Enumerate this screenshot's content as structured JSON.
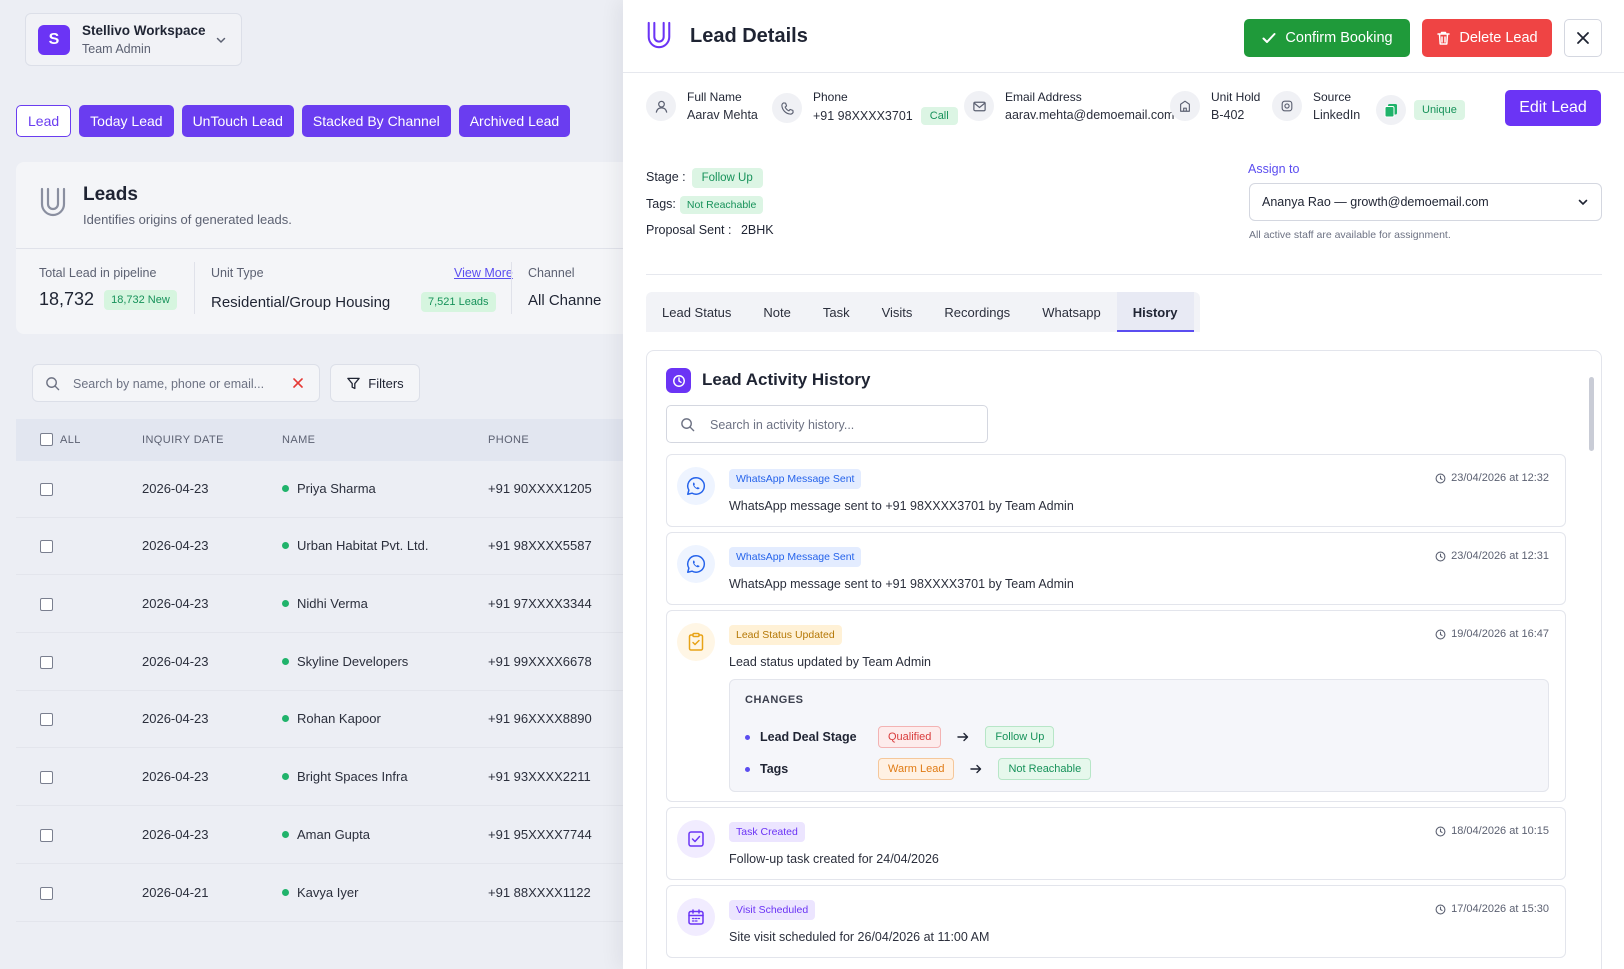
{
  "workspace": {
    "avatar": "S",
    "name": "Stellivo Workspace",
    "role": "Team Admin"
  },
  "top_tabs": [
    {
      "label": "Lead",
      "active": true
    },
    {
      "label": "Today Lead",
      "active": false
    },
    {
      "label": "UnTouch Lead",
      "active": false
    },
    {
      "label": "Stacked By Channel",
      "active": false
    },
    {
      "label": "Archived Lead",
      "active": false
    }
  ],
  "leads_panel": {
    "title": "Leads",
    "subtitle": "Identifies origins of generated leads.",
    "stats": {
      "total_label": "Total Lead in pipeline",
      "total_value": "18,732",
      "total_badge": "18,732 New",
      "unit_label": "Unit Type",
      "unit_value": "Residential/Group Housing",
      "unit_badge": "7,521 Leads",
      "view_more": "View More",
      "channel_label": "Channel",
      "channel_value": "All Channe"
    }
  },
  "list_search": {
    "placeholder": "Search by name, phone or email...",
    "filters_label": "Filters"
  },
  "table": {
    "headers": {
      "all": "ALL",
      "date": "INQUIRY DATE",
      "name": "NAME",
      "phone": "PHONE"
    },
    "rows": [
      {
        "date": "2026-04-23",
        "name": "Priya Sharma",
        "phone": "+91 90XXXX1205"
      },
      {
        "date": "2026-04-23",
        "name": "Urban Habitat Pvt. Ltd.",
        "phone": "+91 98XXXX5587"
      },
      {
        "date": "2026-04-23",
        "name": "Nidhi Verma",
        "phone": "+91 97XXXX3344"
      },
      {
        "date": "2026-04-23",
        "name": "Skyline Developers",
        "phone": "+91 99XXXX6678"
      },
      {
        "date": "2026-04-23",
        "name": "Rohan Kapoor",
        "phone": "+91 96XXXX8890"
      },
      {
        "date": "2026-04-23",
        "name": "Bright Spaces Infra",
        "phone": "+91 93XXXX2211"
      },
      {
        "date": "2026-04-23",
        "name": "Aman Gupta",
        "phone": "+91 95XXXX7744"
      },
      {
        "date": "2026-04-21",
        "name": "Kavya Iyer",
        "phone": "+91 88XXXX1122"
      }
    ]
  },
  "drawer": {
    "title": "Lead Details",
    "confirm_label": "Confirm Booking",
    "delete_label": "Delete Lead",
    "edit_label": "Edit Lead",
    "info": {
      "full_name_label": "Full Name",
      "full_name": "Aarav Mehta",
      "phone_label": "Phone",
      "phone": "+91 98XXXX3701",
      "call_label": "Call",
      "email_label": "Email Address",
      "email": "aarav.mehta@demoemail.com",
      "unit_label": "Unit Hold",
      "unit": "B-402",
      "source_label": "Source",
      "source": "LinkedIn",
      "unique_label": "Unique"
    },
    "meta": {
      "stage_label": "Stage :",
      "stage": "Follow Up",
      "tags_label": "Tags:",
      "tag": "Not Reachable",
      "proposal_label": "Proposal Sent :",
      "proposal": "2BHK"
    },
    "assign": {
      "label": "Assign to",
      "value": "Ananya Rao — growth@demoemail.com",
      "hint": "All active staff are available for assignment."
    },
    "tabs": [
      {
        "label": "Lead Status",
        "active": false
      },
      {
        "label": "Note",
        "active": false
      },
      {
        "label": "Task",
        "active": false
      },
      {
        "label": "Visits",
        "active": false
      },
      {
        "label": "Recordings",
        "active": false
      },
      {
        "label": "Whatsapp",
        "active": false
      },
      {
        "label": "History",
        "active": true
      }
    ],
    "history": {
      "title": "Lead Activity History",
      "search_placeholder": "Search in activity history...",
      "events": [
        {
          "tag": "WhatsApp Message Sent",
          "desc": "WhatsApp message sent to +91 98XXXX3701 by Team Admin",
          "time": "23/04/2026 at 12:32"
        },
        {
          "tag": "WhatsApp Message Sent",
          "desc": "WhatsApp message sent to +91 98XXXX3701 by Team Admin",
          "time": "23/04/2026 at 12:31"
        },
        {
          "tag": "Lead Status Updated",
          "desc": "Lead status updated by Team Admin",
          "time": "19/04/2026 at 16:47"
        },
        {
          "tag": "Task Created",
          "desc": "Follow-up task created for 24/04/2026",
          "time": "18/04/2026 at 10:15"
        },
        {
          "tag": "Visit Scheduled",
          "desc": "Site visit scheduled for 26/04/2026 at 11:00 AM",
          "time": "17/04/2026 at 15:30"
        }
      ],
      "changes": {
        "heading": "CHANGES",
        "items": [
          {
            "field": "Lead Deal Stage",
            "from": "Qualified",
            "to": "Follow Up"
          },
          {
            "field": "Tags",
            "from": "Warm Lead",
            "to": "Not Reachable"
          }
        ]
      }
    }
  },
  "colors": {
    "primary": "#6b34f5",
    "success": "#1f9a3a",
    "danger": "#ef4444",
    "whatsapp_blue": "#2563eb"
  }
}
